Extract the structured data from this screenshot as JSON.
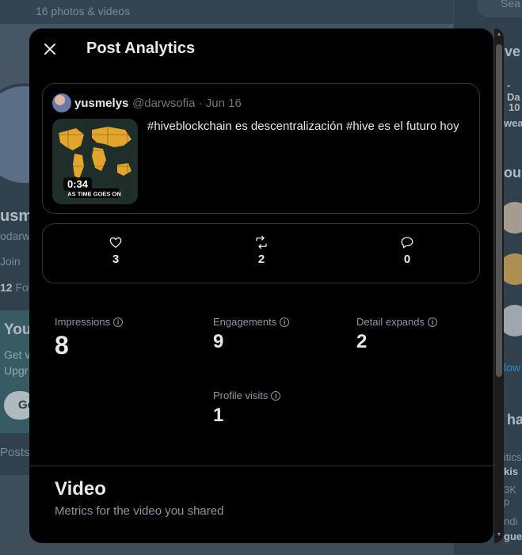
{
  "background": {
    "subtitle": "16 photos & videos",
    "name": "usm",
    "handle": "odarw",
    "joined": "Join",
    "follow_count": "12",
    "follow_label": "Fol",
    "premium_title": "You",
    "premium_text_1": "Get v",
    "premium_text_2": "Upgr",
    "premium_button": "Ge",
    "posts_tab": "Posts",
    "search_placeholder": "Sea",
    "right_1": "ve",
    "right_2": "- Da",
    "right_3": "10",
    "right_4": "wea",
    "right_5": "ou",
    "right_6": "low",
    "right_7": "ha",
    "right_8": "itics",
    "right_9": "kis",
    "right_10": "3K p",
    "right_11": "ndi",
    "right_12": "gue"
  },
  "modal": {
    "title": "Post Analytics",
    "post": {
      "author_name": "yusmelys",
      "meta": "@darwsofia · Jun 16",
      "text": "#hiveblockchain  es descentralización #hive es el futuro hoy",
      "video_duration": "0:34",
      "video_caption": "AS TIME GOES ON"
    },
    "engagement": {
      "likes": "3",
      "reposts": "2",
      "replies": "0"
    },
    "metrics": {
      "impressions_label": "Impressions",
      "impressions_value": "8",
      "engagements_label": "Engagements",
      "engagements_value": "9",
      "detail_expands_label": "Detail expands",
      "detail_expands_value": "2",
      "profile_visits_label": "Profile visits",
      "profile_visits_value": "1"
    },
    "video_section": {
      "title": "Video",
      "subtitle": "Metrics for the video you shared"
    }
  },
  "colors": {
    "modal_bg": "#000000",
    "border": "#2f3336",
    "text_primary": "#e7e9ea",
    "text_secondary": "#8b98a5"
  }
}
